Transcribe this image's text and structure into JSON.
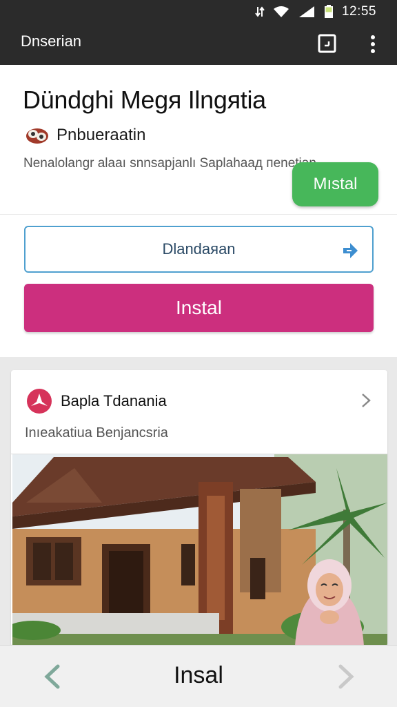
{
  "status_bar": {
    "time": "12:55",
    "icons": [
      "data-transfer-icon",
      "wifi-icon",
      "signal-icon",
      "battery-icon"
    ]
  },
  "app_bar": {
    "title": "Dnserian",
    "actions": [
      "square-icon",
      "more-vert-icon"
    ]
  },
  "header": {
    "headline": "Dündghi Megя Ilngяtia",
    "publisher": "Pnbueraatin",
    "description": "Nenalolangr alaaı snnsapjanlı Saplahaaд пеnetian",
    "mini_install_label": "Mıstal"
  },
  "actions": {
    "outline_label": "Dlandaяan",
    "install_label": "Instal"
  },
  "listing": {
    "title": "Bapla Tdanania",
    "subtitle": "Inıeakatiua Benjancsria"
  },
  "bottom_bar": {
    "label": "Insal"
  },
  "colors": {
    "app_bar": "#2b2b2b",
    "install_green": "#47b75a",
    "install_pink": "#cc2f7e",
    "outline_blue": "#4fa0cf",
    "listing_logo": "#d6335a"
  }
}
